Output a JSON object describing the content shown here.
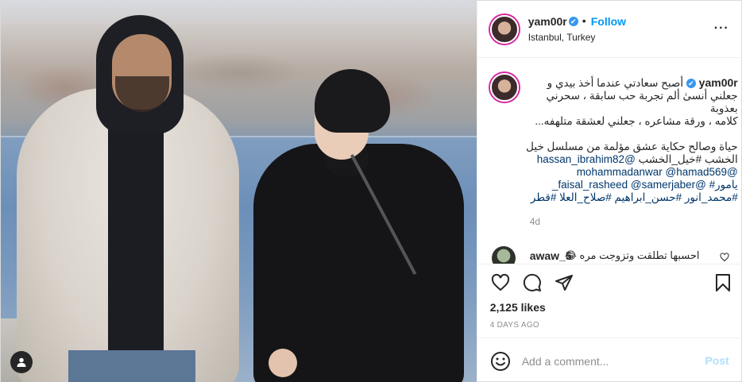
{
  "post": {
    "user": {
      "username": "yam00r",
      "verified_mark": "✔",
      "separator": "•",
      "follow_label": "Follow",
      "location": "Istanbul, Turkey"
    },
    "more_icon": "···",
    "caption": {
      "username": "yam00r",
      "line_1": "أصبح سعادتي عندما أخذ بيدي و",
      "line_2": "جعلني أنسىٰ ألم تجربة حب سابقة ، سحرني بعذوبة",
      "line_3": "كلامه ، ورقة مشاعره ، جعلني لعشقة متلهفه...",
      "line_4": "حياة وصالح حكاية عشق مؤلمة من مسلسل خيل",
      "line_5_text": "الخشب #خيل_الخشب",
      "line_5_mention": "@hassan_ibrahim82",
      "line_6": "@mohammadanwar @hamad569",
      "line_7": "يامور# @faisal_rasheed @samerjaber_",
      "line_8": "#محمد_انور #حسن_ابراهيم #صلاح_العلا #قطر",
      "time_ago": "4d"
    },
    "comment": {
      "username": "awaw_5",
      "text": "احسبها تطلقت وتزوجت مره 😂"
    },
    "likes": "2,125 likes",
    "posted_date": "4 DAYS AGO",
    "add_comment_placeholder": "Add a comment...",
    "post_label": "Post",
    "colors": {
      "link_blue": "#0095f6",
      "text": "#262626",
      "muted": "#8e8e8e",
      "post_disabled": "#b2dffc",
      "verified": "#3897f0"
    },
    "icons": [
      "heart-icon",
      "comment-icon",
      "share-icon",
      "bookmark-icon",
      "emoji-icon",
      "user-tag-icon",
      "more-icon",
      "verified-icon"
    ]
  }
}
